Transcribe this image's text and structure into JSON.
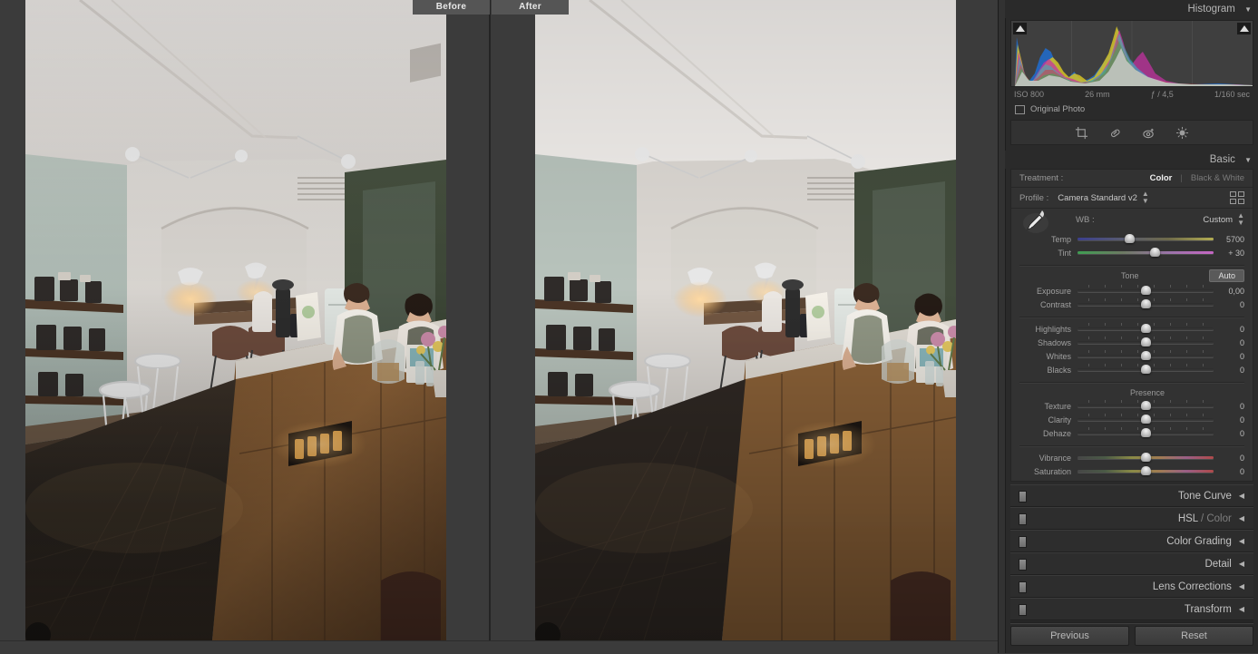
{
  "preview": {
    "tab_before": "Before",
    "tab_after": "After"
  },
  "histogram": {
    "title": "Histogram",
    "caret": "▼",
    "exif": {
      "iso": "ISO 800",
      "focal": "26 mm",
      "aperture": "ƒ / 4,5",
      "shutter": "1/160 sec"
    },
    "original_photo_label": "Original Photo"
  },
  "tools": [
    {
      "name": "crop-tool",
      "title": "Crop"
    },
    {
      "name": "spot-removal-tool",
      "title": "Healing"
    },
    {
      "name": "red-eye-tool",
      "title": "Red Eye"
    },
    {
      "name": "masking-tool",
      "title": "Masking"
    }
  ],
  "basic": {
    "title": "Basic",
    "caret": "▼",
    "treatment_label": "Treatment :",
    "treatment_color": "Color",
    "treatment_sep": "|",
    "treatment_bw": "Black & White",
    "profile_label": "Profile :",
    "profile_value": "Camera Standard v2",
    "wb_label": "WB :",
    "wb_value": "Custom",
    "white_balance": [
      {
        "name": "Temp",
        "value": "5700",
        "pos": 38,
        "grad": "grad-temp"
      },
      {
        "name": "Tint",
        "value": "+ 30",
        "pos": 57,
        "grad": "grad-tint"
      }
    ],
    "tone_label": "Tone",
    "auto_label": "Auto",
    "tone_top": [
      {
        "name": "Exposure",
        "value": "0,00",
        "pos": 50,
        "grad": ""
      },
      {
        "name": "Contrast",
        "value": "0",
        "pos": 50,
        "grad": ""
      }
    ],
    "tone_bottom": [
      {
        "name": "Highlights",
        "value": "0",
        "pos": 50,
        "grad": ""
      },
      {
        "name": "Shadows",
        "value": "0",
        "pos": 50,
        "grad": ""
      },
      {
        "name": "Whites",
        "value": "0",
        "pos": 50,
        "grad": ""
      },
      {
        "name": "Blacks",
        "value": "0",
        "pos": 50,
        "grad": ""
      }
    ],
    "presence_label": "Presence",
    "presence_top": [
      {
        "name": "Texture",
        "value": "0",
        "pos": 50,
        "grad": ""
      },
      {
        "name": "Clarity",
        "value": "0",
        "pos": 50,
        "grad": ""
      },
      {
        "name": "Dehaze",
        "value": "0",
        "pos": 50,
        "grad": ""
      }
    ],
    "presence_bottom": [
      {
        "name": "Vibrance",
        "value": "0",
        "pos": 50,
        "grad": "grad-vib"
      },
      {
        "name": "Saturation",
        "value": "0",
        "pos": 50,
        "grad": "grad-vib"
      }
    ]
  },
  "collapsed_panels": [
    {
      "name": "Tone Curve",
      "dim": "",
      "caret": "◀"
    },
    {
      "name": "HSL ",
      "dim": "/ Color",
      "caret": "◀"
    },
    {
      "name": "Color Grading",
      "dim": "",
      "caret": "◀"
    },
    {
      "name": "Detail",
      "dim": "",
      "caret": "◀"
    },
    {
      "name": "Lens Corrections",
      "dim": "",
      "caret": "◀"
    },
    {
      "name": "Transform",
      "dim": "",
      "caret": "◀"
    }
  ],
  "footer": {
    "previous": "Previous",
    "reset": "Reset"
  },
  "colors": {
    "panel_bg": "#2a2a2a",
    "canvas_bg": "#3b3b3b",
    "accent_text": "#f0f0f0"
  }
}
